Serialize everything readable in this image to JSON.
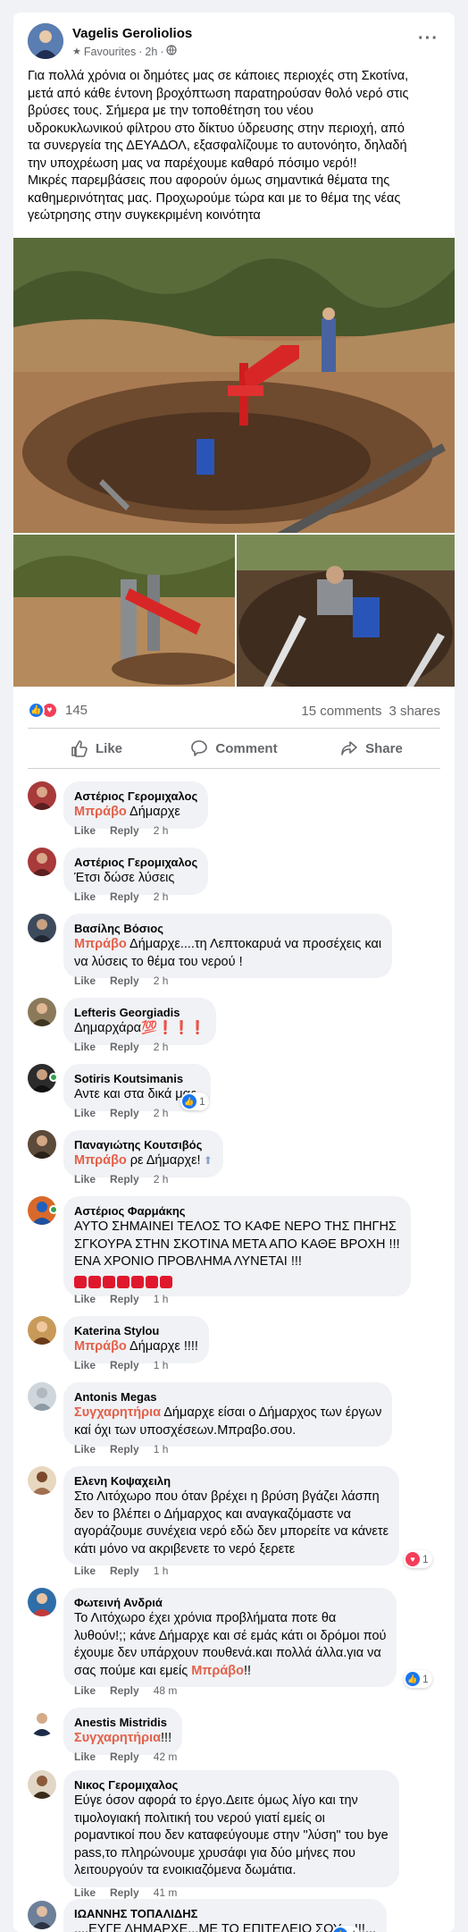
{
  "post": {
    "author": "Vagelis Geroliolios",
    "audience": "Favourites",
    "time": "2h",
    "text_lines": [
      "Για πολλά χρόνια οι δημότες μας σε κάποιες περιοχές στη Σκοτίνα,",
      "μετά από κάθε έντονη βροχόπτωση παρατηρούσαν θολό νερό στις",
      "βρύσες τους. Σήμερα με την τοποθέτηση του νέου",
      "υδροκυκλωνικού φίλτρου στο δίκτυο ύδρευσης στην περιοχή, από",
      "τα συνεργεία της ΔΕΥΑΔΟΛ, εξασφαλίζουμε το αυτονόητο, δηλαδή",
      "την υποχρέωση μας να παρέχουμε καθαρό πόσιμο νερό!!",
      "Μικρές παρεμβάσεις που αφορούν όμως σημαντικά θέματα της",
      "καθημερινότητας μας. Προχωρούμε τώρα και με το θέμα της νέας",
      "γεώτρησης στην συγκεκριμένη κοινότητα"
    ],
    "reactions_count": "145",
    "comments_count": "15 comments",
    "shares_count": "3 shares",
    "actions": {
      "like": "Like",
      "comment": "Comment",
      "share": "Share"
    }
  },
  "comment_actions": {
    "like": "Like",
    "reply": "Reply"
  },
  "comments": [
    {
      "name": "Αστέριος Γερομιχαλος",
      "highlight": "Μπράβο",
      "text": " Δήμαρχε",
      "time": "2 h"
    },
    {
      "name": "Αστέριος Γερομιχαλος",
      "text": "Έτσι δώσε λύσεις",
      "time": "2 h"
    },
    {
      "name": "Βασίλης Βόσιος",
      "highlight": "Μπράβο",
      "text_lines": [
        " Δήμαρχε....τη Λεπτοκαρυά να προσέχεις και",
        "να λύσεις το θέμα του νερού !"
      ],
      "time": "2 h"
    },
    {
      "name": "Lefteris Georgiadis",
      "text": "Δημαρχάρα💯❗❗❗",
      "time": "2 h"
    },
    {
      "name": "Sotiris Koutsimanis",
      "text": "Αντε και στα δικά μας.",
      "time": "2 h",
      "reaction_count": "1"
    },
    {
      "name": "Παναγιώτης Κουτσιβός",
      "highlight": "Μπράβο",
      "text": " ρε Δήμαρχε!",
      "time": "2 h"
    },
    {
      "name": "Αστέριος Φαρμάκης",
      "text_lines": [
        "ΑΥΤΟ ΣΗΜΑΙΝΕΙ ΤΕΛΟΣ ΤΟ ΚΑΦΕ ΝΕΡΟ ΤΗΣ ΠΗΓΗΣ",
        "ΣΓΚΟΥΡΑ ΣΤΗΝ ΣΚΟΤΙΝΑ ΜΕΤΑ ΑΠΟ ΚΑΘΕ ΒΡΟΧΗ !!!",
        "ΕΝΑ ΧΡΟΝΙΟ ΠΡΟΒΛΗΜΑ ΛΥΝΕΤΑΙ !!!"
      ],
      "time": "1 h"
    },
    {
      "name": "Katerina Stylou",
      "highlight": "Μπράβο",
      "text": " Δήμαρχε !!!!",
      "time": "1 h"
    },
    {
      "name": "Antonis Megas",
      "highlight": "Συγχαρητήρια",
      "text_lines": [
        " Δήμαρχε είσαι ο Δήμαρχος των έργων",
        "καί όχι των υποσχέσεων.Μπραβο.σου."
      ],
      "time": "1 h"
    },
    {
      "name": "Ελενη Κοψαχειλη",
      "text_lines": [
        "Στο Λιτόχωρο που όταν βρέχει η βρύση βγάζει λάσπη",
        "δεν το βλέπει ο Δήμαρχος και αναγκαζόμαστε να",
        "αγοράζουμε συνέχεια νερό εδώ δεν μπορείτε να κάνετε",
        "κάτι μόνο να ακριβενετε το νερό ξερετε"
      ],
      "time": "1 h",
      "reaction_count": "1"
    },
    {
      "name": "Φωτεινή Ανδριά",
      "text_lines": [
        "Το Λιτόχωρο έχει χρόνια προβλήματα ποτε θα",
        "λυθούν!;; κάνε Δήμαρχε και σέ εμάς κάτι οι δρόμοι πού",
        "έχουμε δεν υπάρχουν πουθενά.και πολλά άλλα.για να",
        "σας πούμε και εμείς "
      ],
      "highlight_end": "Μπράβο",
      "end": "!!",
      "time": "48 m",
      "reaction_count": "1"
    },
    {
      "name": "Anestis Mistridis",
      "highlight": "Συγχαρητήρια",
      "text": "!!!",
      "time": "42 m"
    },
    {
      "name": "Νικος Γερομιχαλος",
      "text_lines": [
        "Εύγε όσον αφορά το έργο.Δειτε όμως λίγο και την",
        "τιμολογιακή πολιτική του νερού γιατί εμείς οι",
        "ρομαντικοί που δεν καταφεύγουμε στην \"λύση\" του bye",
        "pass,το πληρώνουμε χρυσάφι για δύο μήνες που",
        "λειτουργούν τα ενοικιαζόμενα δωμάτια."
      ],
      "time": "41 m"
    },
    {
      "name": "ΙΩΑΝΝΗΣ ΤΟΠΑΛΙΔΗΣ",
      "text": "....ΕΥΓΕ ΔΗΜΑΡΧΕ...ΜΕ ΤΟ ΕΠΙΤΕΛΕΙΟ ΣΟΥ....!!!...",
      "reaction_count": "4"
    }
  ],
  "icons": {
    "audience": "favourites-star-icon",
    "globe": "globe-icon",
    "like": "thumbs-up-icon",
    "love": "heart-icon",
    "comment": "comment-bubble-icon",
    "share": "share-arrow-icon",
    "more": "more-dots-icon"
  },
  "colors": {
    "like_blue": "#1877f2",
    "love_red": "#f33e58",
    "highlight_red": "#f02849",
    "secondary_text": "#65676b",
    "bubble_bg": "#f0f2f5"
  }
}
